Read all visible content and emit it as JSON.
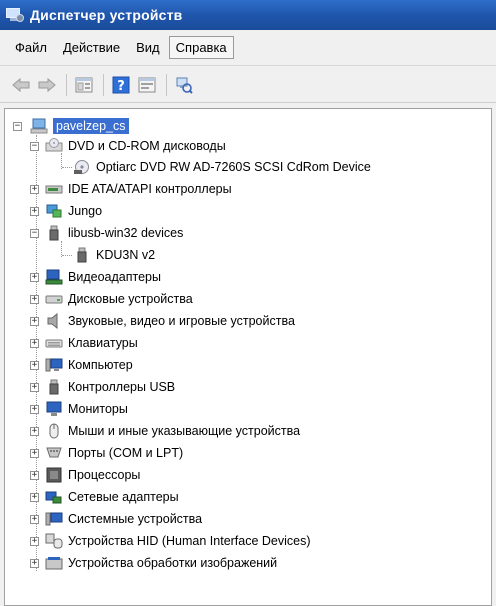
{
  "window": {
    "title": "Диспетчер устройств"
  },
  "menu": {
    "items": [
      {
        "label": "Файл"
      },
      {
        "label": "Действие"
      },
      {
        "label": "Вид"
      },
      {
        "label": "Справка"
      }
    ]
  },
  "toolbar": {
    "buttons": [
      {
        "icon": "back-arrow-icon"
      },
      {
        "icon": "forward-arrow-icon"
      },
      {
        "icon": "properties-icon"
      },
      {
        "icon": "help-icon"
      },
      {
        "icon": "show-hide-icon"
      },
      {
        "icon": "scan-hardware-icon"
      }
    ]
  },
  "tree": {
    "root": "pavelzep_cs",
    "dvd": {
      "label": "DVD и CD-ROM дисководы",
      "child": "Optiarc DVD RW AD-7260S SCSI CdRom Device"
    },
    "ide": "IDE ATA/ATAPI контроллеры",
    "jungo": "Jungo",
    "libusb": {
      "label": "libusb-win32 devices",
      "child": "KDU3N v2"
    },
    "video": "Видеоадаптеры",
    "disk": "Дисковые устройства",
    "sound": "Звуковые, видео и игровые устройства",
    "keyboard": "Клавиатуры",
    "computer": "Компьютер",
    "usb": "Контроллеры USB",
    "monitors": "Мониторы",
    "mice": "Мыши и иные указывающие устройства",
    "ports": "Порты (COM и LPT)",
    "cpu": "Процессоры",
    "network": "Сетевые адаптеры",
    "system": "Системные устройства",
    "hid": "Устройства HID (Human Interface Devices)",
    "imaging": "Устройства обработки изображений"
  }
}
